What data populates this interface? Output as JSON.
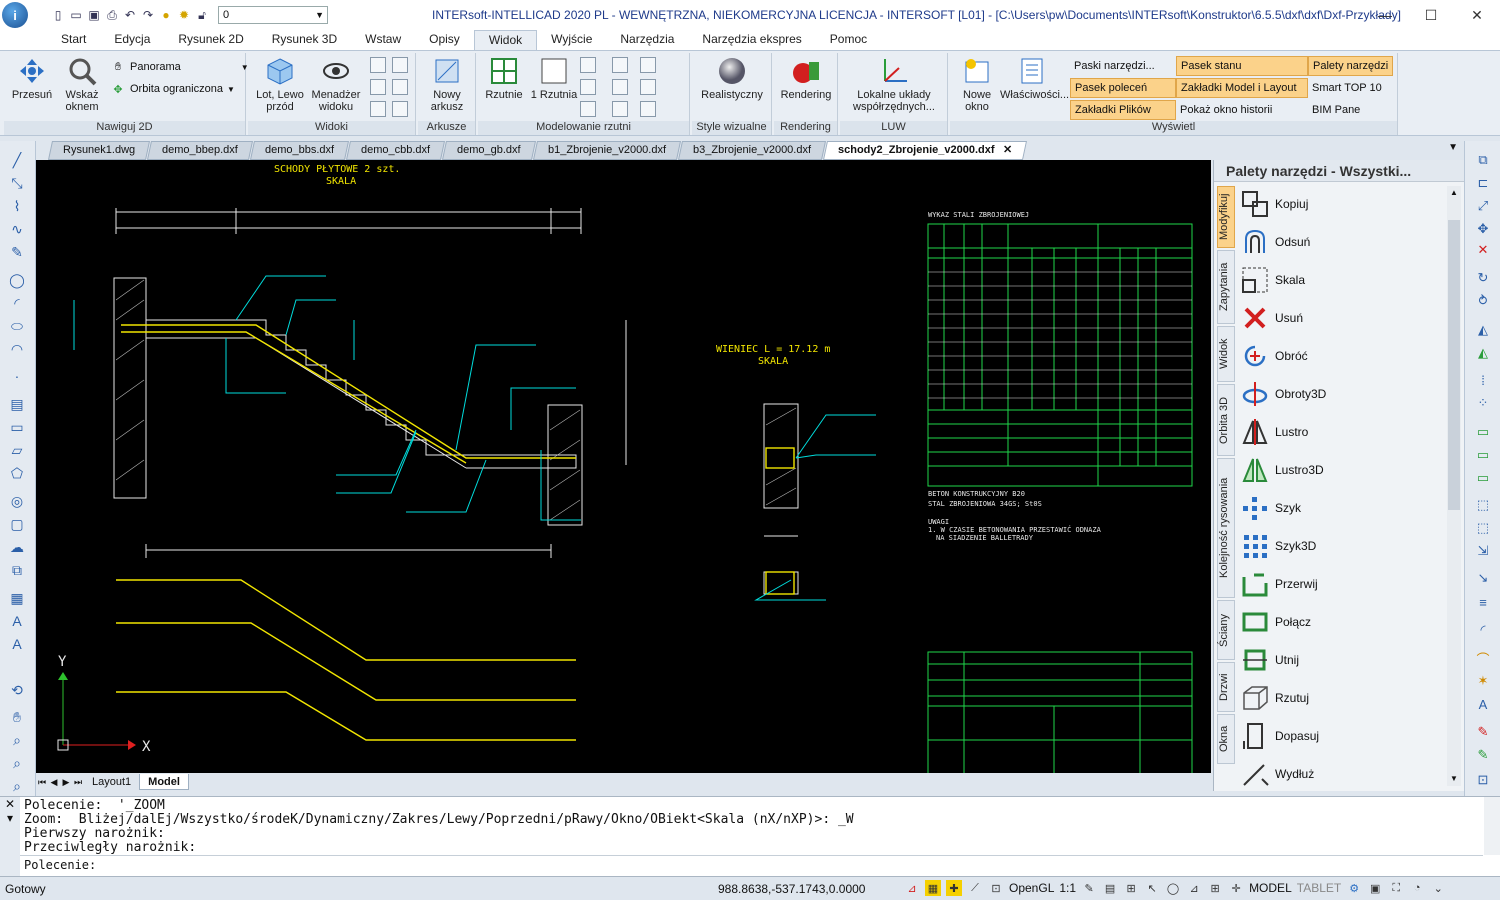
{
  "app": {
    "title": "INTERsoft-INTELLICAD 2020 PL - WEWNĘTRZNA, NIEKOMERCYJNA LICENCJA - INTERSOFT [L01] - [C:\\Users\\pw\\Documents\\INTERsoft\\Konstruktor\\6.5.5\\dxf\\dxf\\Dxf-Przykłady]",
    "logo_letter": "i",
    "layer_value": "0"
  },
  "ribbon_tabs": [
    "Start",
    "Edycja",
    "Rysunek 2D",
    "Rysunek 3D",
    "Wstaw",
    "Opisy",
    "Widok",
    "Wyjście",
    "Narzędzia",
    "Narzędzia ekspres",
    "Pomoc"
  ],
  "ribbon": {
    "nav2d": {
      "title": "Nawiguj 2D",
      "pan_label": "Przesuń",
      "zoom_label": "Wskaż oknem",
      "panorama": "Panorama",
      "orbit": "Orbita ograniczona"
    },
    "views": {
      "title": "Widoki",
      "view1": "Lot, Lewo przód",
      "view2": "Menadżer widoku"
    },
    "sheets": {
      "title": "Arkusze",
      "new": "Nowy arkusz"
    },
    "model": {
      "title": "Modelowanie rzutni",
      "rzutnie": "Rzutnie",
      "one": "1 Rzutnia"
    },
    "style": {
      "title": "Style wizualne",
      "real": "Realistyczny"
    },
    "render": {
      "title": "Rendering",
      "btn": "Rendering"
    },
    "luw": {
      "title": "LUW",
      "btn": "Lokalne układy współrzędnych..."
    },
    "show": {
      "title": "Wyświetl",
      "new_window": "Nowe okno",
      "props": "Właściwości...",
      "toolbars": "Paski narzędzi...",
      "statusbar": "Pasek stanu",
      "palettes": "Palety narzędzi",
      "cmdbar": "Pasek poleceń",
      "model_layout": "Zakładki Model i Layout",
      "smart": "Smart TOP 10",
      "file_tabs": "Zakładki Plików",
      "history": "Pokaż okno historii",
      "bim": "BIM Pane"
    }
  },
  "doc_tabs": [
    "Rysunek1.dwg",
    "demo_bbep.dxf",
    "demo_bbs.dxf",
    "demo_cbb.dxf",
    "demo_gb.dxf",
    "b1_Zbrojenie_v2000.dxf",
    "b3_Zbrojenie_v2000.dxf",
    "schody2_Zbrojenie_v2000.dxf"
  ],
  "drawing": {
    "title1": "SCHODY PŁYTOWE 2 szt.",
    "scale1": "SKALA",
    "title2": "WIENIEC L = 17.12 m",
    "scale2": "SKALA",
    "table_title": "WYKAZ STALI ZBROJENIOWEJ",
    "concrete": "BETON KONSTRUKCYJNY B20",
    "steel": "STAL ZBROJENIOWA 34GS; St0S",
    "note_head": "UWAGI",
    "note1": "1. W CZASIE BETONOWANIA PRZESTAWIĆ ODNAZA",
    "note2": "NA SIADZENIE BALLETRADY",
    "axis_y": "Y",
    "axis_x": "X"
  },
  "layout_tabs": {
    "layout1": "Layout1",
    "model": "Model"
  },
  "palette": {
    "title": "Palety narzędzi - Wszystki...",
    "vtabs": [
      "Modyfikuj",
      "Zapytania",
      "Widok",
      "Orbita 3D",
      "Kolejność rysowania",
      "Ściany",
      "Drzwi",
      "Okna"
    ],
    "items": [
      "Kopiuj",
      "Odsuń",
      "Skala",
      "Usuń",
      "Obróć",
      "Obroty3D",
      "Lustro",
      "Lustro3D",
      "Szyk",
      "Szyk3D",
      "Przerwij",
      "Połącz",
      "Utnij",
      "Rzutuj",
      "Dopasuj",
      "Wydłuż"
    ]
  },
  "command": {
    "line1": "Polecenie:  '_ZOOM",
    "line2": "Zoom:  Bliżej/dalEj/Wszystko/środeK/Dynamiczny/Zakres/Lewy/Poprzedni/pRawy/Okno/OBiekt<Skala (nX/nXP)>: _W",
    "line3": "Pierwszy narożnik:",
    "line4": "Przeciwległy narożnik:",
    "prompt": "Polecenie:"
  },
  "status": {
    "ready": "Gotowy",
    "coords": "988.8638,-537.1743,0.0000",
    "opengl": "OpenGL",
    "scale": "1:1",
    "model": "MODEL",
    "tablet": "TABLET"
  }
}
